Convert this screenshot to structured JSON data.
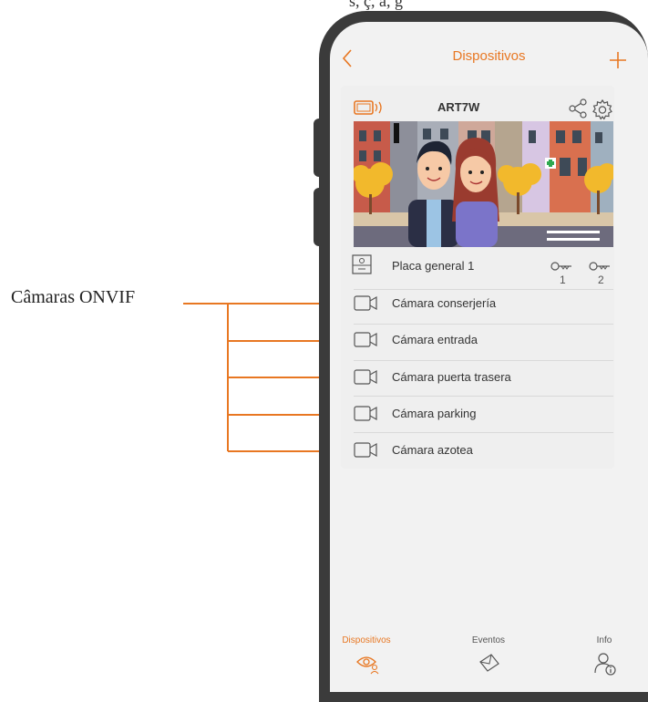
{
  "top_text": "s, ç, a, g",
  "callout": {
    "label": "Câmaras ONVIF"
  },
  "header": {
    "title": "Dispositivos"
  },
  "device": {
    "name": "ART7W",
    "panel_label": "Placa general 1",
    "keys": [
      {
        "number": "1"
      },
      {
        "number": "2"
      }
    ]
  },
  "cameras": [
    {
      "label": "Cámara conserjería"
    },
    {
      "label": "Cámara entrada"
    },
    {
      "label": "Cámara puerta trasera"
    },
    {
      "label": "Cámara parking"
    },
    {
      "label": "Cámara azotea"
    }
  ],
  "tabbar": {
    "tabs": [
      {
        "label": "Dispositivos",
        "active": true,
        "icon": "eye-user-icon"
      },
      {
        "label": "Eventos",
        "active": false,
        "icon": "envelope-icon"
      },
      {
        "label": "Info",
        "active": false,
        "icon": "user-info-icon"
      }
    ]
  },
  "colors": {
    "accent": "#e87722",
    "phone_body": "#3b3b3b",
    "screen_bg": "#f2f2f2"
  }
}
